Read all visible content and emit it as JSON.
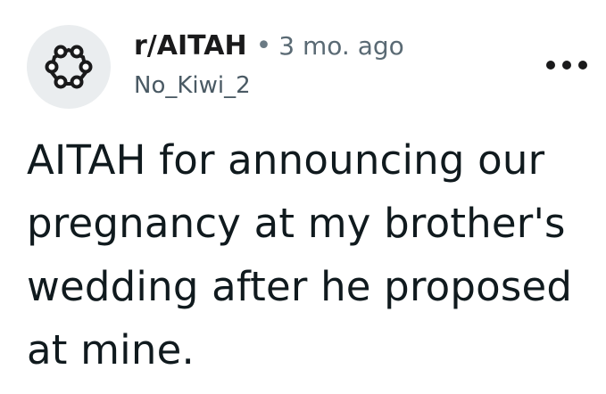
{
  "post": {
    "subreddit": "r/AITAH",
    "separator": "•",
    "time_ago": "3 mo. ago",
    "author": "No_Kiwi_2",
    "avatar_icon": "community-snoo-icon",
    "more_icon": "more-options-icon",
    "title": "AITAH for announcing our pregnancy at my brother's wedding after he proposed at mine."
  },
  "colors": {
    "text_primary": "#1a1a1b",
    "text_secondary": "#4a5a64",
    "avatar_bg": "#eaedef"
  }
}
